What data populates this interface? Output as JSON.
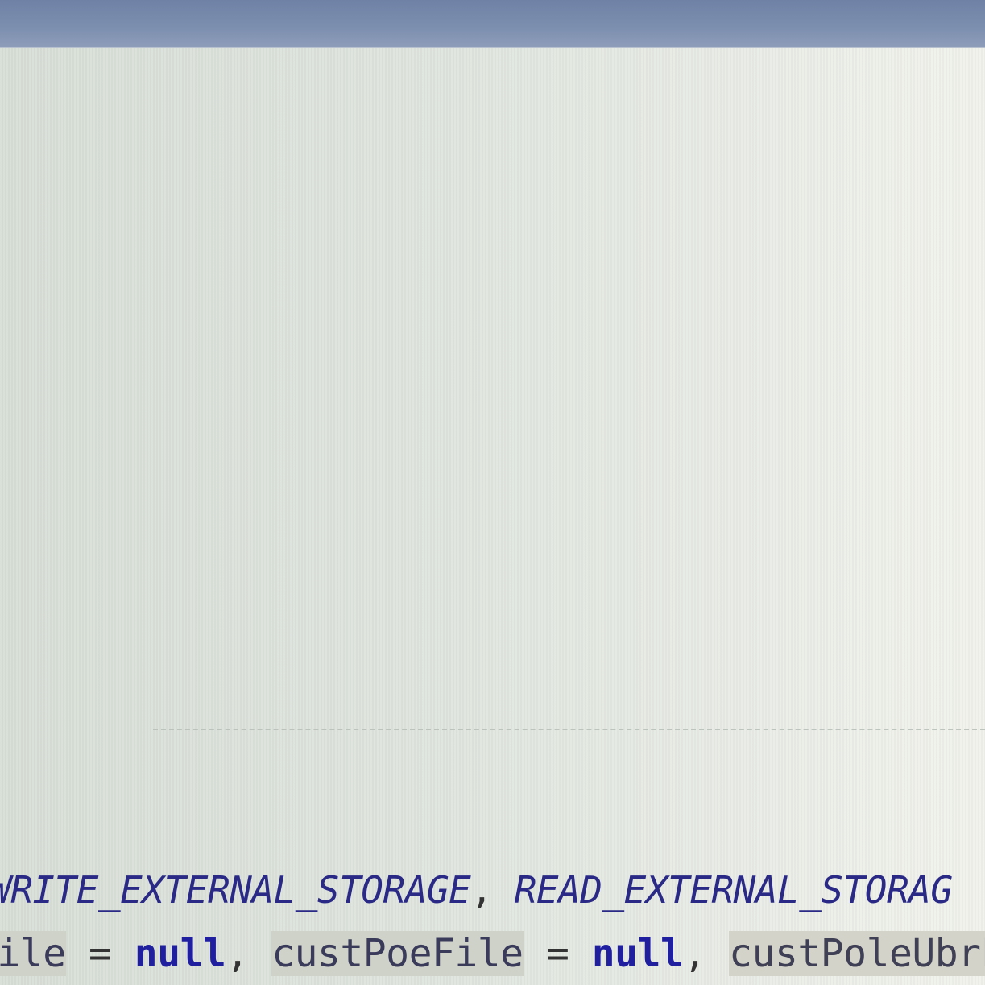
{
  "editor": {
    "line_1": {
      "const_a": "WRITE_EXTERNAL_STORAGE",
      "separator": ", ",
      "const_b": "READ_EXTERNAL_STORAG"
    },
    "line_2": {
      "var_a": "File",
      "assign_a": " = ",
      "null_a": "null",
      "sep_a": ", ",
      "var_b": "custPoeFile",
      "assign_b": " = ",
      "null_b": "null",
      "sep_b": ", ",
      "var_c": "custPoleUbrF"
    }
  },
  "colors": {
    "title_strip": "#7d8faf",
    "editor_background": "#dde3dc",
    "constant": "#2a2a86",
    "keyword": "#1f1fa0",
    "identifier_highlight": "#cfd2c8"
  }
}
